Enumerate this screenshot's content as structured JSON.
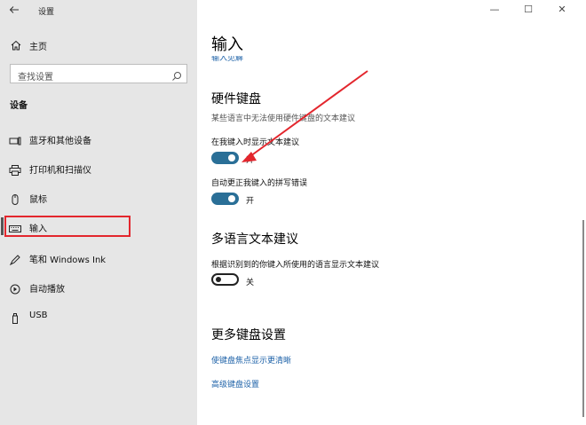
{
  "window": {
    "title": "设置",
    "minimize": "—",
    "maximize": "☐",
    "close": "✕"
  },
  "sidebar": {
    "home": "主页",
    "search_placeholder": "查找设置",
    "section": "设备",
    "items": [
      {
        "label": "蓝牙和其他设备",
        "icon": "bluetooth-devices-icon"
      },
      {
        "label": "打印机和扫描仪",
        "icon": "printer-icon"
      },
      {
        "label": "鼠标",
        "icon": "mouse-icon"
      },
      {
        "label": "输入",
        "icon": "keyboard-icon",
        "active": true
      },
      {
        "label": "笔和 Windows Ink",
        "icon": "pen-icon"
      },
      {
        "label": "自动播放",
        "icon": "autoplay-icon"
      },
      {
        "label": "USB",
        "icon": "usb-icon"
      }
    ]
  },
  "main": {
    "title": "输入",
    "cut_link": "输入见解",
    "hardware": {
      "heading": "硬件键盘",
      "description": "某些语言中无法使用硬件键盘的文本建议",
      "option1_label": "在我键入时显示文本建议",
      "option1_state": "开",
      "option2_label": "自动更正我键入的拼写错误",
      "option2_state": "开"
    },
    "multilang": {
      "heading": "多语言文本建议",
      "option_label": "根据识别到的你键入所使用的语言显示文本建议",
      "option_state": "关"
    },
    "more": {
      "heading": "更多键盘设置",
      "link1": "使键盘焦点显示更清晰",
      "link2": "高级键盘设置"
    }
  },
  "colors": {
    "accent": "#2a6f97",
    "link": "#1e62a8",
    "annotation": "#e3262d",
    "sidebar_bg": "#e6e6e6"
  }
}
